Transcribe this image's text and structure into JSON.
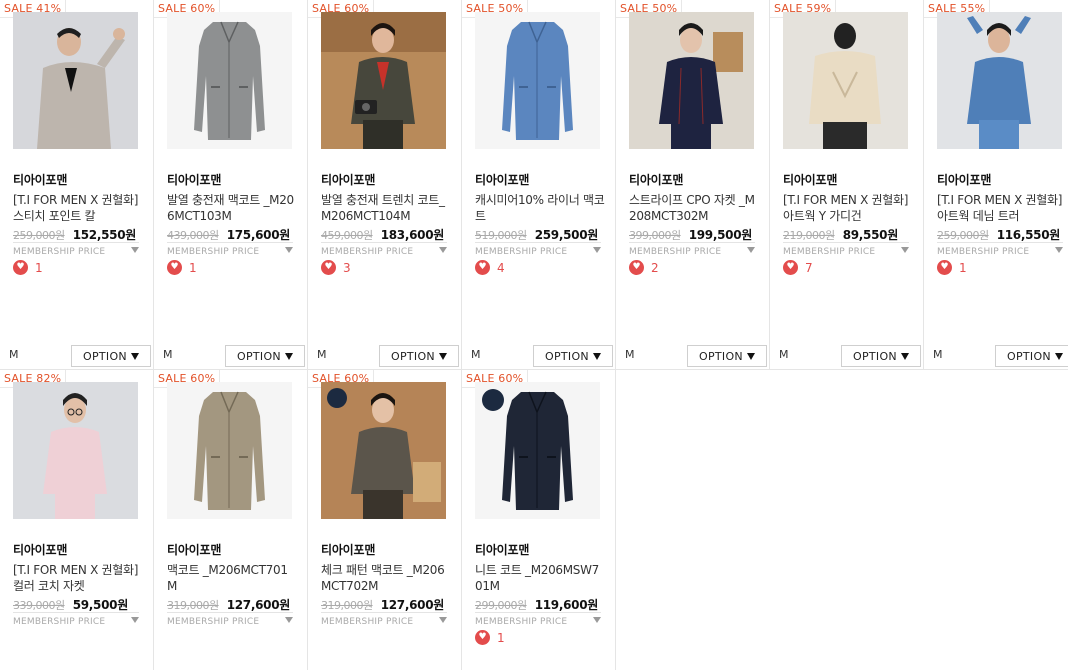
{
  "size_label": "M",
  "option_label": "OPTION",
  "membership_label": "MEMBERSHIP PRICE",
  "products": [
    {
      "sale": "SALE 41%",
      "brand": "티아이포맨",
      "title": "[T.I FOR MEN X 권혈화] 스티치 포인트 칼",
      "orig": "259,000원",
      "price": "152,550원",
      "likes": "1",
      "image": "model-jacket-beige"
    },
    {
      "sale": "SALE 60%",
      "brand": "티아이포맨",
      "title": "발열 충전재 맥코트 _M206MCT103M",
      "orig": "439,000원",
      "price": "175,600원",
      "likes": "1",
      "image": "coat-grey"
    },
    {
      "sale": "SALE 60%",
      "brand": "티아이포맨",
      "title": "발열 충전재 트렌치 코트_M206MCT104M",
      "orig": "459,000원",
      "price": "183,600원",
      "likes": "3",
      "image": "model-trench-khaki"
    },
    {
      "sale": "SALE 50%",
      "brand": "티아이포맨",
      "title": "캐시미어10% 라이너 맥코트",
      "orig": "519,000원",
      "price": "259,500원",
      "likes": "4",
      "image": "coat-blue"
    },
    {
      "sale": "SALE 50%",
      "brand": "티아이포맨",
      "title": "스트라이프 CPO 자켓 _M208MCT302M",
      "orig": "399,000원",
      "price": "199,500원",
      "likes": "2",
      "image": "model-navy-stripe"
    },
    {
      "sale": "SALE 59%",
      "brand": "티아이포맨",
      "title": "[T.I FOR MEN X 권혈화] 아트웍 Y 가디건",
      "orig": "219,000원",
      "price": "89,550원",
      "likes": "7",
      "image": "model-cardigan-back"
    },
    {
      "sale": "SALE 55%",
      "brand": "티아이포맨",
      "title": "[T.I FOR MEN X 권혈화] 아트웍 데님 트러",
      "orig": "259,000원",
      "price": "116,550원",
      "likes": "1",
      "image": "model-denim"
    },
    {
      "sale": "SALE 82%",
      "brand": "티아이포맨",
      "title": "[T.I FOR MEN X 권혈화] 컬러 코치 자켓",
      "orig": "339,000원",
      "price": "59,500원",
      "likes": "",
      "image": "model-pink"
    },
    {
      "sale": "SALE 60%",
      "brand": "티아이포맨",
      "title": "맥코트 _M206MCT701M",
      "orig": "319,000원",
      "price": "127,600원",
      "likes": "",
      "image": "coat-beige"
    },
    {
      "sale": "SALE 60%",
      "brand": "티아이포맨",
      "title": "체크 패턴 맥코트 _M206MCT702M",
      "orig": "319,000원",
      "price": "127,600원",
      "likes": "",
      "image": "model-check-coat"
    },
    {
      "sale": "SALE 60%",
      "brand": "티아이포맨",
      "title": "니트 코트 _M206MSW701M",
      "orig": "299,000원",
      "price": "119,600원",
      "likes": "1",
      "image": "coat-navy-knit"
    }
  ]
}
